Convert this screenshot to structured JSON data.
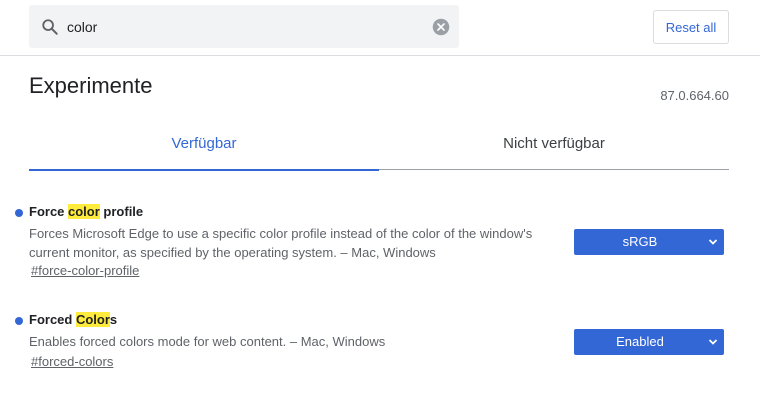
{
  "search": {
    "value": "color"
  },
  "header": {
    "reset_label": "Reset all"
  },
  "page": {
    "title": "Experimente",
    "version": "87.0.664.60"
  },
  "tabs": [
    {
      "label": "Verfügbar",
      "active": true
    },
    {
      "label": "Nicht verfügbar",
      "active": false
    }
  ],
  "experiments": [
    {
      "title_prefix": "Force ",
      "title_highlight": "color",
      "title_suffix": " profile",
      "description": "Forces Microsoft Edge to use a specific color profile instead of the color of the window's current monitor, as specified by the operating system. – Mac, Windows",
      "link": "#force-color-profile",
      "selected": "sRGB"
    },
    {
      "title_prefix": "Forced ",
      "title_highlight": "Color",
      "title_suffix": "s",
      "description": "Enables forced colors mode for web content. – Mac, Windows",
      "link": "#forced-colors",
      "selected": "Enabled"
    }
  ],
  "colors": {
    "accent": "#3367d6",
    "highlight": "#ffeb3b",
    "search_bg": "#f1f3f4"
  },
  "icons": {
    "search": "search-icon",
    "clear": "clear-icon",
    "dropdown": "chevron-down-icon"
  }
}
